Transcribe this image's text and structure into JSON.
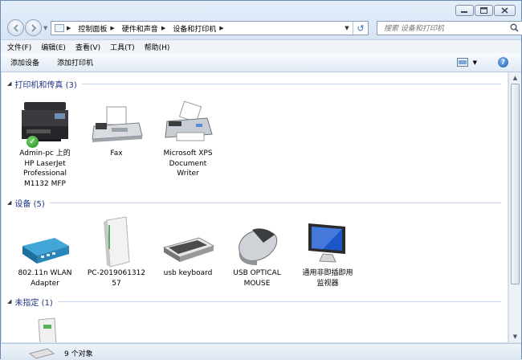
{
  "window": {
    "caption": {
      "minimize": "minimize",
      "maximize": "maximize",
      "close": "close"
    }
  },
  "address": {
    "crumbs": [
      "控制面板",
      "硬件和声音",
      "设备和打印机"
    ],
    "search_placeholder": "搜索 设备和打印机"
  },
  "menu": {
    "file": "文件(F)",
    "edit": "编辑(E)",
    "view": "查看(V)",
    "tools": "工具(T)",
    "help": "帮助(H)"
  },
  "commands": {
    "add_device": "添加设备",
    "add_printer": "添加打印机",
    "help_symbol": "?"
  },
  "groups": {
    "printers": {
      "title": "打印机和传真 (3)",
      "items": [
        {
          "label": "Admin-pc 上的\nHP LaserJet\nProfessional\nM1132 MFP",
          "icon": "multifunction-printer-icon",
          "default": true
        },
        {
          "label": "Fax",
          "icon": "fax-icon"
        },
        {
          "label": "Microsoft XPS\nDocument\nWriter",
          "icon": "printer-icon"
        }
      ]
    },
    "devices": {
      "title": "设备 (5)",
      "items": [
        {
          "label": "802.11n WLAN\nAdapter",
          "icon": "wlan-adapter-icon"
        },
        {
          "label": "PC-2019061312\n57",
          "icon": "computer-tower-icon"
        },
        {
          "label": "usb keyboard",
          "icon": "keyboard-icon"
        },
        {
          "label": "USB OPTICAL\nMOUSE",
          "icon": "mouse-icon"
        },
        {
          "label": "通用非即插即用\n监视器",
          "icon": "monitor-icon"
        }
      ]
    },
    "unspecified": {
      "title": "未指定 (1)",
      "items": [
        {
          "label": "",
          "icon": "device-box-icon"
        }
      ]
    }
  },
  "status": {
    "count": "9 个对象"
  },
  "colors": {
    "group_title": "#1e3287",
    "accent": "#2e6bbf",
    "check": "#1f8a1e"
  }
}
